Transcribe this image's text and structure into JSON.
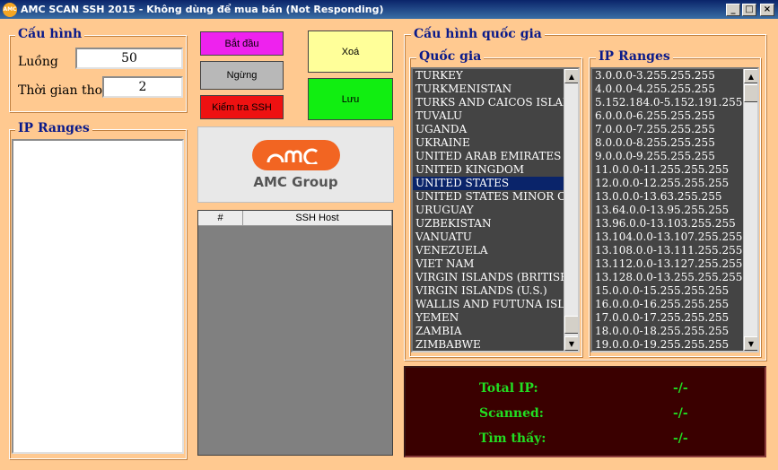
{
  "window": {
    "title": "AMC SCAN SSH  2015 - Không dùng để mua bán (Not Responding)",
    "logo": "amc",
    "min": "_",
    "max": "□",
    "close": "×"
  },
  "config": {
    "legend": "Cấu hình",
    "threads_label": "Luồng",
    "threads_value": "50",
    "timeout_label": "Thời gian thoát",
    "timeout_value": "2"
  },
  "ip_left": {
    "legend": "IP Ranges"
  },
  "buttons": {
    "start": "Bắt đầu",
    "stop": "Ngừng",
    "check": "Kiểm tra SSH",
    "delete": "Xoá",
    "save": "Lưu"
  },
  "colors": {
    "start": "#ee22ee",
    "stop": "#b8b8b8",
    "check": "#ee1111",
    "delete": "#ffff99",
    "save": "#11ee11"
  },
  "logo_box": {
    "mark": "amc",
    "text": "AMC Group"
  },
  "ssh_table": {
    "columns": [
      "#",
      "SSH Host"
    ]
  },
  "country_config": {
    "legend": "Cấu hình quốc gia"
  },
  "country": {
    "legend": "Quốc gia",
    "items": [
      "TURKEY",
      "TURKMENISTAN",
      "TURKS AND CAICOS ISLANDS",
      "TUVALU",
      "UGANDA",
      "UKRAINE",
      "UNITED ARAB EMIRATES",
      "UNITED KINGDOM",
      "UNITED STATES",
      "UNITED STATES MINOR OUTLYING ISLANDS",
      "URUGUAY",
      "UZBEKISTAN",
      "VANUATU",
      "VENEZUELA",
      "VIET NAM",
      "VIRGIN ISLANDS (BRITISH)",
      "VIRGIN ISLANDS (U.S.)",
      "WALLIS AND FUTUNA ISLANDS",
      "YEMEN",
      "ZAMBIA",
      "ZIMBABWE"
    ],
    "selected": "UNITED STATES"
  },
  "ranges": {
    "legend": "IP Ranges",
    "items": [
      "3.0.0.0-3.255.255.255",
      "4.0.0.0-4.255.255.255",
      "5.152.184.0-5.152.191.255",
      "6.0.0.0-6.255.255.255",
      "7.0.0.0-7.255.255.255",
      "8.0.0.0-8.255.255.255",
      "9.0.0.0-9.255.255.255",
      "11.0.0.0-11.255.255.255",
      "12.0.0.0-12.255.255.255",
      "13.0.0.0-13.63.255.255",
      "13.64.0.0-13.95.255.255",
      "13.96.0.0-13.103.255.255",
      "13.104.0.0-13.107.255.255",
      "13.108.0.0-13.111.255.255",
      "13.112.0.0-13.127.255.255",
      "13.128.0.0-13.255.255.255",
      "15.0.0.0-15.255.255.255",
      "16.0.0.0-16.255.255.255",
      "17.0.0.0-17.255.255.255",
      "18.0.0.0-18.255.255.255",
      "19.0.0.0-19.255.255.255"
    ]
  },
  "stats": {
    "total_label": "Total IP:",
    "total_value": "-/-",
    "scanned_label": "Scanned:",
    "scanned_value": "-/-",
    "found_label": "Tìm thấy:",
    "found_value": "-/-"
  }
}
